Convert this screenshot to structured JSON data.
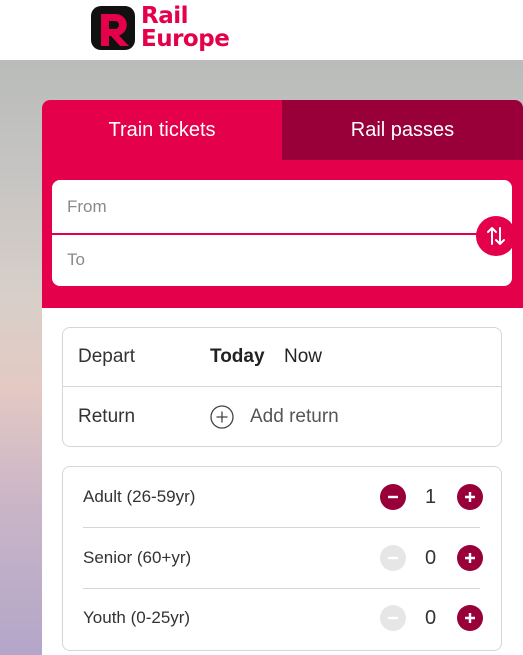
{
  "brand": {
    "line1": "Rail",
    "line2": "Europe",
    "color": "#e4004b"
  },
  "tabs": [
    {
      "label": "Train tickets",
      "active": true
    },
    {
      "label": "Rail passes",
      "active": false
    }
  ],
  "route": {
    "from_placeholder": "From",
    "to_placeholder": "To",
    "swap_icon": "swap-arrows-icon"
  },
  "dates": {
    "depart_label": "Depart",
    "depart_day": "Today",
    "depart_time": "Now",
    "return_label": "Return",
    "add_return_label": "Add return",
    "add_icon": "plus-circle-icon"
  },
  "passengers": [
    {
      "label": "Adult (26-59yr)",
      "count": "1",
      "minus_enabled": true
    },
    {
      "label": "Senior (60+yr)",
      "count": "0",
      "minus_enabled": false
    },
    {
      "label": "Youth (0-25yr)",
      "count": "0",
      "minus_enabled": false
    }
  ],
  "colors": {
    "primary": "#e4004b",
    "secondary": "#99003a"
  }
}
